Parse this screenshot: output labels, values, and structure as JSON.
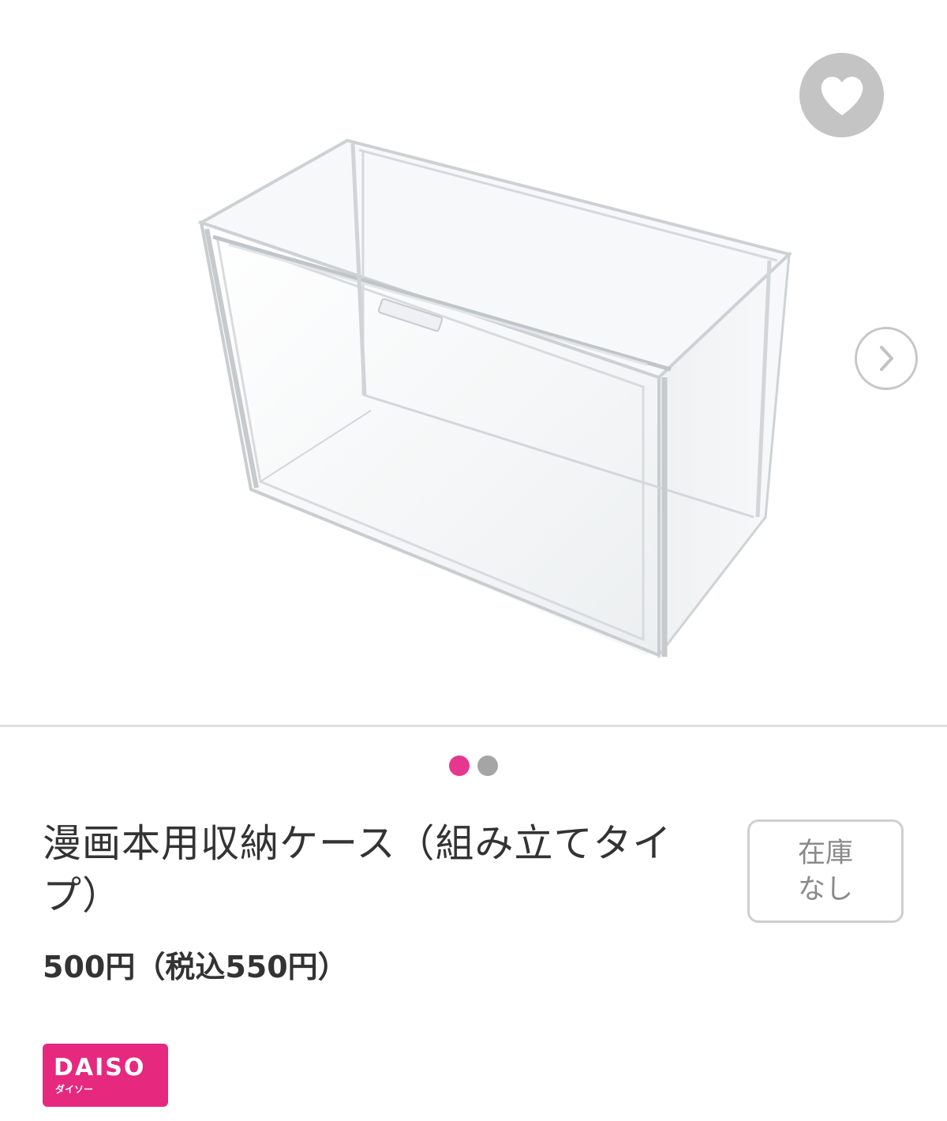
{
  "product": {
    "title": "漫画本用収納ケース（組み立てタイプ）",
    "price": "500円（税込550円）",
    "stock_status": "在庫\nなし"
  },
  "gallery": {
    "current_index": 1,
    "total": 2,
    "image_alt": "クリア収納ケース"
  },
  "icons": {
    "favorite": "heart-icon",
    "next": "chevron-right-icon"
  },
  "brand": {
    "name": "DAISO",
    "kana": "ダイソー"
  },
  "colors": {
    "accent": "#e6378e",
    "brand": "#e6287f",
    "fav_bg": "#c4c4c4",
    "text": "#333333"
  }
}
